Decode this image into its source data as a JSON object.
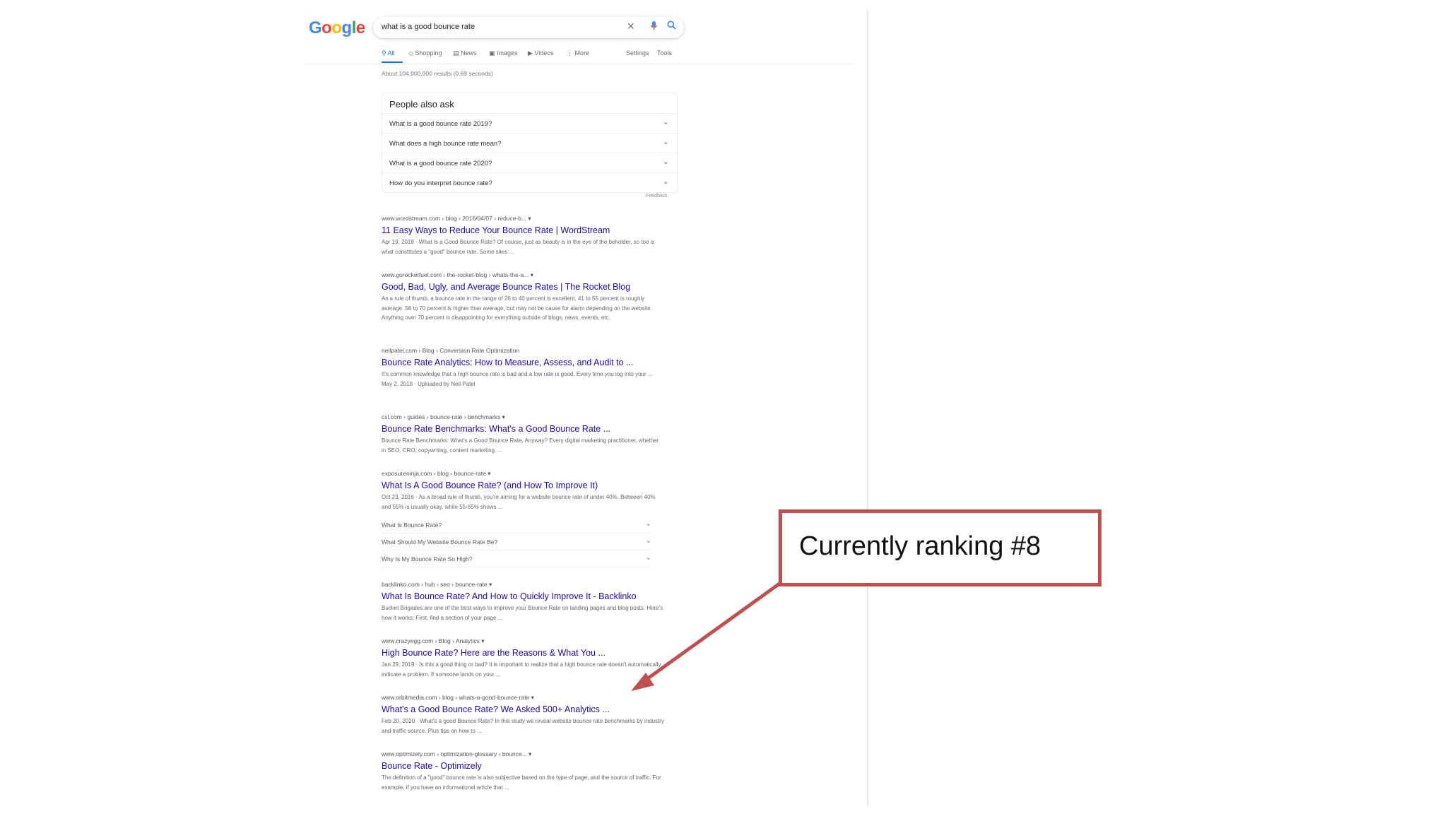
{
  "logo": {
    "letters": [
      "G",
      "o",
      "o",
      "g",
      "l",
      "e"
    ],
    "colors": [
      "#4285F4",
      "#EA4335",
      "#FBBC05",
      "#4285F4",
      "#34A853",
      "#EA4335"
    ]
  },
  "search": {
    "query": "what is a good bounce rate"
  },
  "tabs": [
    "All",
    "Shopping",
    "News",
    "Images",
    "Videos",
    "More",
    "Settings",
    "Tools"
  ],
  "result_stats": "About 104,000,000 results (0.69 seconds)",
  "people_also_ask": {
    "title": "People also ask",
    "questions": [
      "What is a good bounce rate 2019?",
      "What does a high bounce rate mean?",
      "What is a good bounce rate 2020?",
      "How do you interpret bounce rate?"
    ],
    "feedback": "Feedback"
  },
  "results": [
    {
      "url": "www.wordstream.com › blog › 2016/04/07 › reduce-b... ▾",
      "title": "11 Easy Ways to Reduce Your Bounce Rate | WordStream",
      "snippet": "Apr 19, 2018 · What Is a Good Bounce Rate? Of course, just as beauty is in the eye of the beholder, so too is what constitutes a \"good\" bounce rate. Some sites ..."
    },
    {
      "url": "www.gorocketfuel.com › the-rocket-blog › whats-the-a... ▾",
      "title": "Good, Bad, Ugly, and Average Bounce Rates | The Rocket Blog",
      "snippet": "As a rule of thumb, a bounce rate in the range of 26 to 40 percent is excellent. 41 to 55 percent is roughly average. 56 to 70 percent is higher than average, but may not be cause for alarm depending on the website. Anything over 70 percent is disappointing for everything outside of blogs, news, events, etc."
    },
    {
      "url": "neilpatel.com › Blog › Conversion Rate Optimization",
      "title": "Bounce Rate Analytics: How to Measure, Assess, and Audit to ...",
      "snippet": "It's common knowledge that a high bounce rate is bad and a low rate is good. Every time you log into your ...",
      "extra": "May 2, 2018 · Uploaded by Neil Patel"
    },
    {
      "url": "cxl.com › guides › bounce-rate › benchmarks ▾",
      "title": "Bounce Rate Benchmarks: What's a Good Bounce Rate ...",
      "snippet": "Bounce Rate Benchmarks: What's a Good Bounce Rate, Anyway? Every digital marketing practitioner, whether in SEO, CRO, copywriting, content marketing, ..."
    },
    {
      "url": "exposureninja.com › blog › bounce-rate ▾",
      "title": "What Is A Good Bounce Rate? (and How To Improve It)",
      "snippet": "Oct 23, 2016 · As a broad rule of thumb, you're aiming for a website bounce rate of under 40%. Between 40% and 55% is usually okay, while 55-65% shows ..."
    },
    {
      "url": "backlinko.com › hub › seo › bounce-rate ▾",
      "title": "What Is Bounce Rate? And How to Quickly Improve It - Backlinko",
      "snippet": "Bucket Brigades are one of the best ways to improve your Bounce Rate on landing pages and blog posts. Here's how it works: First, find a section of your page ..."
    },
    {
      "url": "www.crazyegg.com › Blog › Analytics ▾",
      "title": "High Bounce Rate? Here are the Reasons & What You ...",
      "snippet": "Jan 29, 2019 · Is this a good thing or bad? It is important to realize that a high bounce rate doesn't automatically indicate a problem. If someone lands on your ..."
    },
    {
      "url": "www.orbitmedia.com › blog › whats-a-good-bounce-rate ▾",
      "title": "What's a Good Bounce Rate? We Asked 500+ Analytics ...",
      "snippet": "Feb 20, 2020 · What's a good Bounce Rate? In this study we reveal website bounce rate benchmarks by industry and traffic source. Plus tips on how to ..."
    },
    {
      "url": "www.optimizely.com › optimization-glossary › bounce... ▾",
      "title": "Bounce Rate - Optimizely",
      "snippet": "The definition of a \"good\" bounce rate is also subjective based on the type of page, and the source of traffic. For example, if you have an informational article that ..."
    }
  ],
  "sub_questions": [
    "What Is Bounce Rate?",
    "What Should My Website Bounce Rate Be?",
    "Why Is My Bounce Rate So High?"
  ],
  "callout": {
    "text": "Currently ranking #8",
    "border_color": "#c0504d",
    "arrow_color": "#c0504d"
  }
}
